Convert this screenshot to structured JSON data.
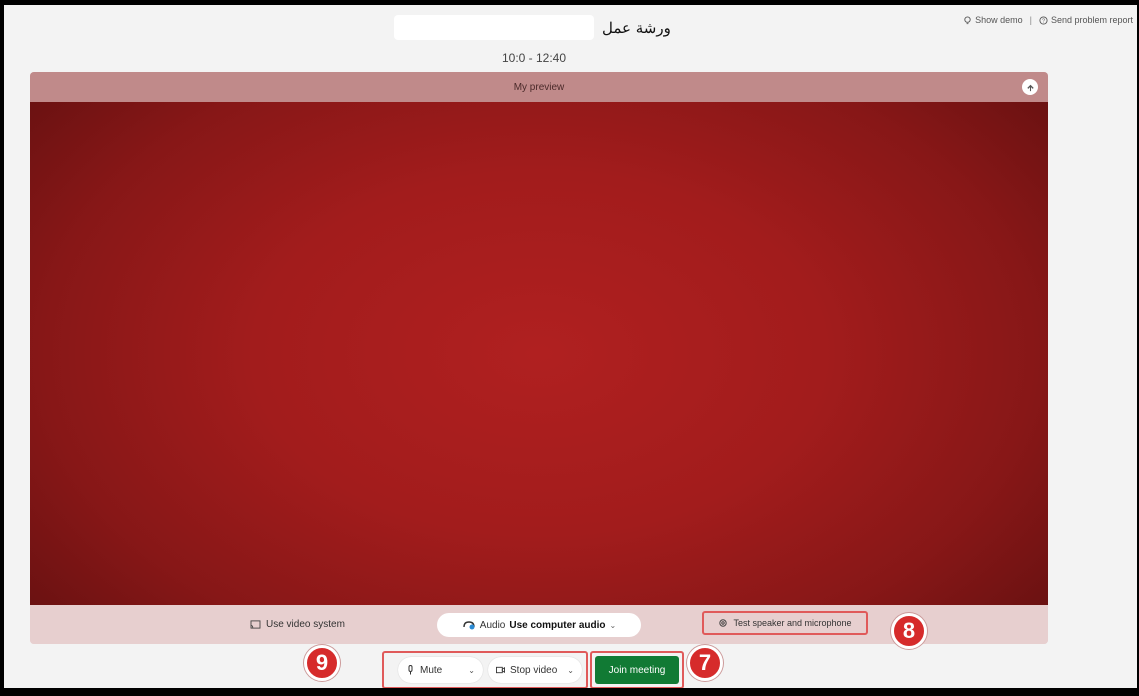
{
  "header": {
    "meeting_title": "ورشة عمل",
    "time_range": "10:0 - 12:40",
    "show_demo": "Show demo",
    "separator": "|",
    "send_problem": "Send problem report"
  },
  "preview": {
    "label": "My preview",
    "use_video_system": "Use video system",
    "audio_prefix": "Audio",
    "audio_value": "Use computer audio",
    "test_speaker": "Test speaker and microphone"
  },
  "controls": {
    "mute_label": "Mute",
    "stop_video_label": "Stop video",
    "join_label": "Join meeting"
  },
  "badges": {
    "b7": "7",
    "b8": "8",
    "b9": "9"
  },
  "colors": {
    "join_green": "#117a34",
    "badge_red": "#d62b2b",
    "highlight_border": "#e05a5a",
    "video_red": "#a21c1c"
  }
}
